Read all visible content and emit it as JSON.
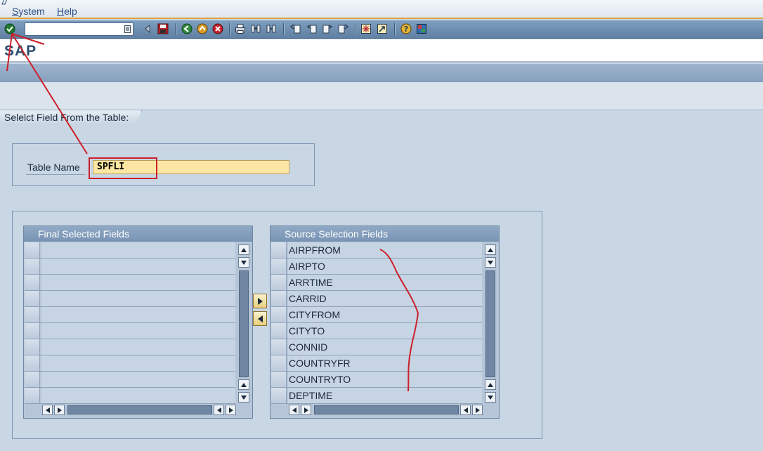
{
  "menu": {
    "items": [
      "System",
      "Help"
    ]
  },
  "toolbar": {
    "command_field_value": "",
    "icons": [
      "enter-icon",
      "command-dropdown-icon",
      "back-triangle-icon",
      "save-icon",
      "back-icon",
      "exit-icon",
      "cancel-icon",
      "print-icon",
      "find-icon",
      "find-next-icon",
      "first-page-icon",
      "previous-page-icon",
      "next-page-icon",
      "last-page-icon",
      "new-session-icon",
      "shortcut-icon",
      "help-icon",
      "layout-icon"
    ]
  },
  "titlebar": {
    "app_label": "SAP"
  },
  "section": {
    "title": "Selelct Field From the Table:"
  },
  "table_name": {
    "label": "Table Name",
    "value": "SPFLI"
  },
  "final_fields": {
    "header": "Final Selected Fields",
    "rows": [
      "",
      "",
      "",
      "",
      "",
      "",
      "",
      "",
      "",
      ""
    ]
  },
  "source_fields": {
    "header": "Source Selection Fields",
    "rows": [
      "AIRPFROM",
      "AIRPTO",
      "ARRTIME",
      "CARRID",
      "CITYFROM",
      "CITYTO",
      "CONNID",
      "COUNTRYFR",
      "COUNTRYTO",
      "DEPTIME"
    ]
  },
  "colors": {
    "annotation": "#cc1f2a",
    "input_required": "#fbe7a3",
    "header_blue": "#7f9bbb",
    "toolbar_accent": "#e2a23c"
  }
}
